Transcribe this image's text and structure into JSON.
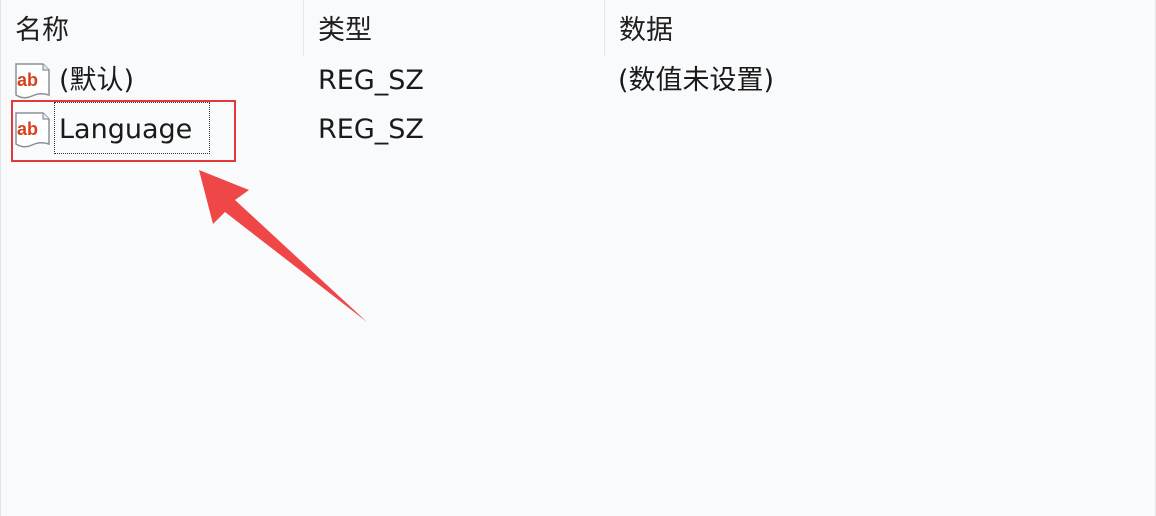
{
  "columns": {
    "name": "名称",
    "type": "类型",
    "data": "数据"
  },
  "rows": [
    {
      "icon": "string-value-icon",
      "icon_text": "ab",
      "name": "(默认)",
      "type": "REG_SZ",
      "data": "(数值未设置)"
    },
    {
      "icon": "string-value-icon",
      "icon_text": "ab",
      "name": "Language",
      "type": "REG_SZ",
      "data": ""
    }
  ],
  "colors": {
    "highlight": "#e23a3a",
    "arrow": "#ef4747",
    "background": "#f9fafc",
    "icon_text": "#d8401e"
  }
}
